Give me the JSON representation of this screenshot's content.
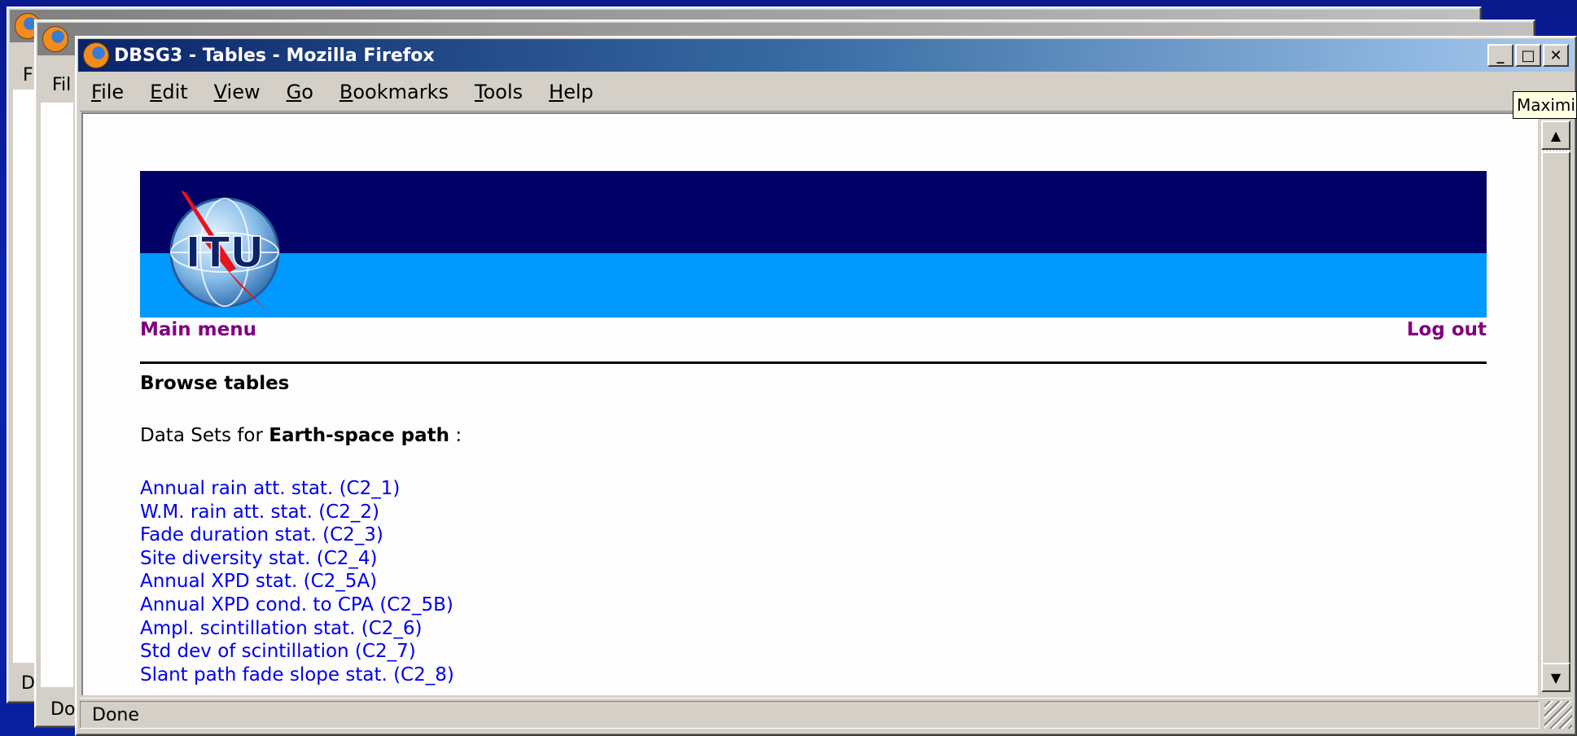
{
  "background_windows": [
    {
      "menu_peek": "F",
      "status_peek": "D"
    },
    {
      "menu_peek": "Fil",
      "status_peek": "Do"
    }
  ],
  "window": {
    "title": "DBSG3 - Tables - Mozilla Firefox",
    "buttons": {
      "minimize": "_",
      "maximize": "□",
      "close": "✕"
    },
    "menu": [
      {
        "label": "File",
        "accel": "F",
        "rest": "ile"
      },
      {
        "label": "Edit",
        "accel": "E",
        "rest": "dit"
      },
      {
        "label": "View",
        "accel": "V",
        "rest": "iew"
      },
      {
        "label": "Go",
        "accel": "G",
        "rest": "o"
      },
      {
        "label": "Bookmarks",
        "accel": "B",
        "rest": "ookmarks"
      },
      {
        "label": "Tools",
        "accel": "T",
        "rest": "ools"
      },
      {
        "label": "Help",
        "accel": "H",
        "rest": "elp"
      }
    ],
    "status": "Done",
    "tooltip": "Maximize"
  },
  "page": {
    "logo_text": "ITU",
    "main_menu": "Main menu",
    "log_out": "Log out",
    "heading": "Browse tables",
    "datasets_prefix": "Data Sets for",
    "datasets_subject": "Earth-space path",
    "datasets_suffix": ":",
    "links": [
      "Annual rain att. stat. (C2_1)",
      "W.M. rain att. stat. (C2_2)",
      "Fade duration stat. (C2_3)",
      "Site diversity stat. (C2_4)",
      "Annual XPD stat. (C2_5A)",
      "Annual XPD cond. to CPA (C2_5B)",
      "Ampl. scintillation stat. (C2_6)",
      "Std dev of scintillation (C2_7)",
      "Slant path fade slope stat. (C2_8)"
    ]
  },
  "colors": {
    "banner_dark": "#000066",
    "banner_light": "#0099ff",
    "visited_link": "#800080",
    "link": "#0000ee"
  }
}
